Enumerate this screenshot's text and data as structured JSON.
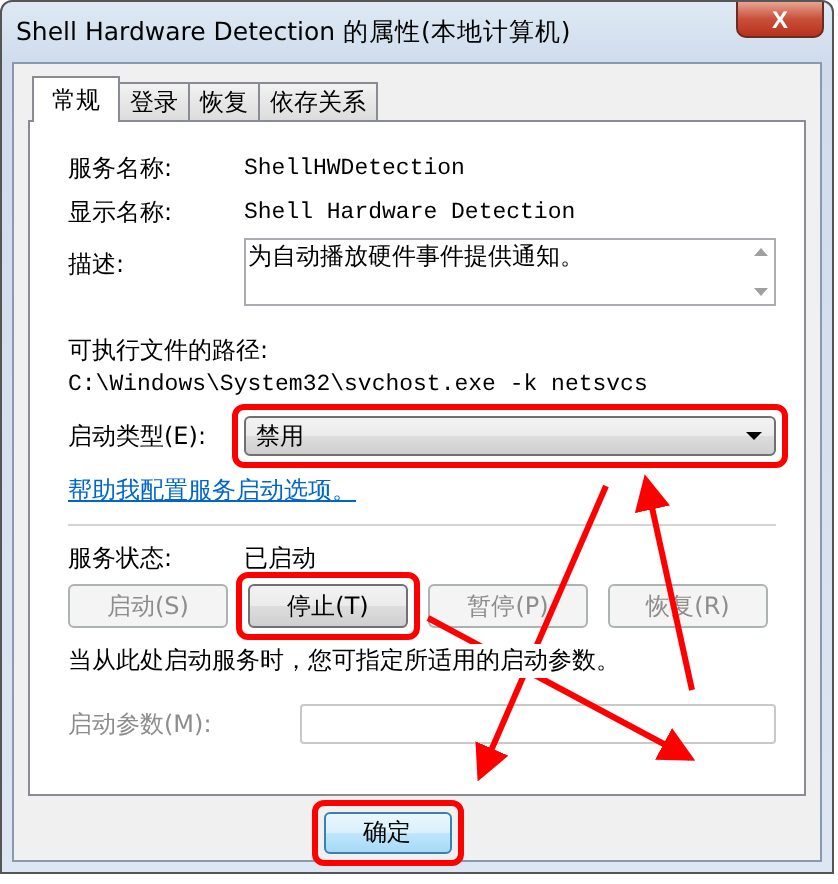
{
  "window": {
    "title": "Shell Hardware Detection 的属性(本地计算机)",
    "close": "X"
  },
  "tabs": [
    {
      "label": "常规",
      "selected": true
    },
    {
      "label": "登录",
      "selected": false
    },
    {
      "label": "恢复",
      "selected": false
    },
    {
      "label": "依存关系",
      "selected": false
    }
  ],
  "fields": [
    {
      "label": "服务名称:",
      "value": "ShellHWDetection"
    },
    {
      "label": "显示名称:",
      "value": "Shell Hardware Detection"
    }
  ],
  "description": {
    "label": "描述:",
    "value": "为自动播放硬件事件提供通知。"
  },
  "path": {
    "label": "可执行文件的路径:",
    "value": "C:\\Windows\\System32\\svchost.exe -k netsvcs"
  },
  "startup_type": {
    "label": "启动类型(E):",
    "value": "禁用",
    "highlighted": true
  },
  "help_link": "帮助我配置服务启动选项。",
  "status": {
    "label": "服务状态:",
    "value": "已启动"
  },
  "service_buttons": [
    {
      "label": "启动(S)",
      "disabled": true,
      "highlighted": false
    },
    {
      "label": "停止(T)",
      "disabled": false,
      "highlighted": true
    },
    {
      "label": "暂停(P)",
      "disabled": true,
      "highlighted": false
    },
    {
      "label": "恢复(R)",
      "disabled": true,
      "highlighted": false
    }
  ],
  "note": "当从此处启动服务时，您可指定所适用的启动参数。",
  "start_params": {
    "label": "启动参数(M):",
    "disabled": true
  },
  "footer_buttons": [
    {
      "label": "确定",
      "highlighted": true
    }
  ],
  "annotation_arrows": true
}
